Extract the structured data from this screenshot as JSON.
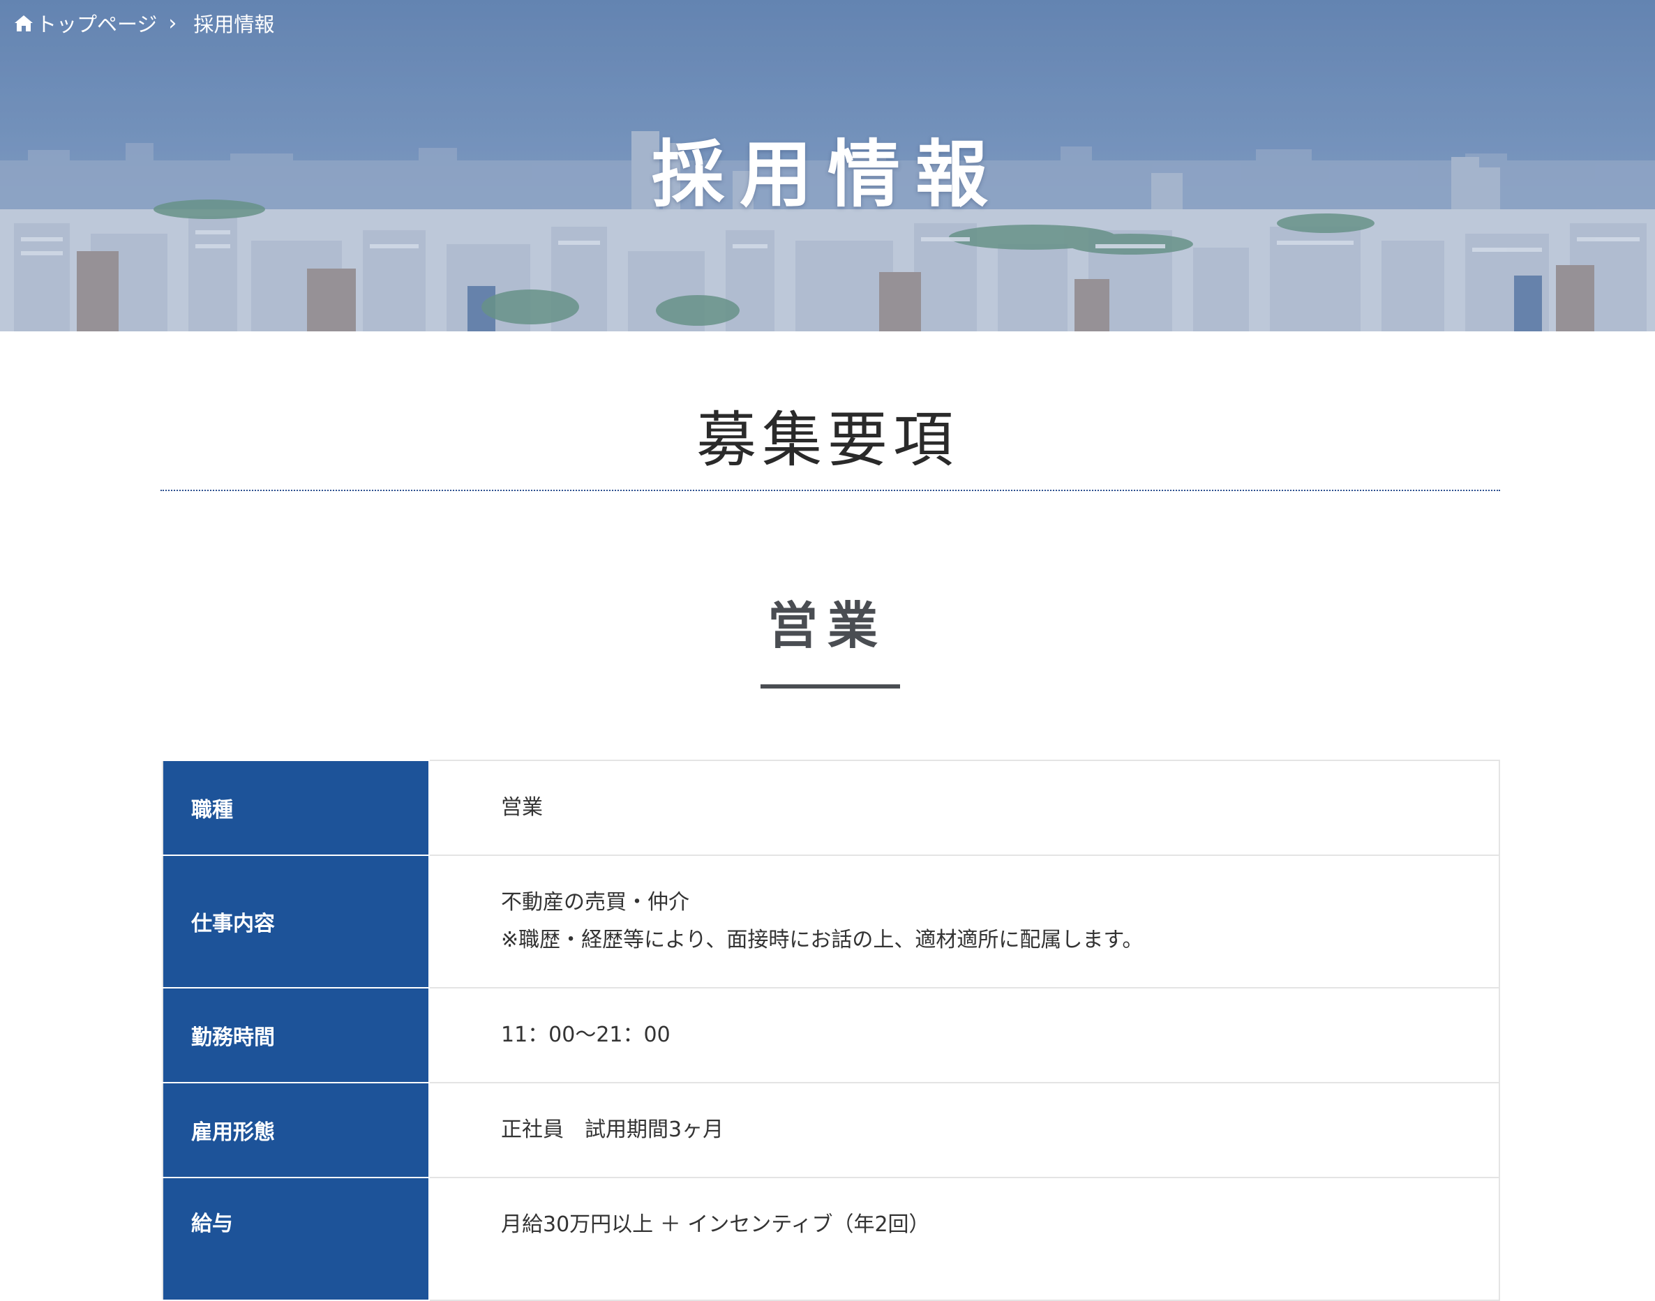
{
  "breadcrumb": {
    "home_label": "トップページ",
    "separator": "›",
    "current": "採用情報"
  },
  "hero": {
    "title": "採用情報"
  },
  "section": {
    "title": "募集要項"
  },
  "job": {
    "title": "営業"
  },
  "table": {
    "rows": [
      {
        "label": "職種",
        "lines": [
          "営業"
        ]
      },
      {
        "label": "仕事内容",
        "lines": [
          "不動産の売買・仲介",
          "※職歴・経歴等により、面接時にお話の上、適材適所に配属します。"
        ]
      },
      {
        "label": "勤務時間",
        "lines": [
          "11：00〜21：00"
        ]
      },
      {
        "label": "雇用形態",
        "lines": [
          "正社員　試用期間3ヶ月"
        ]
      },
      {
        "label": "給与",
        "lines": [
          "月給30万円以上 ＋ インセンティブ（年2回）"
        ]
      }
    ]
  },
  "colors": {
    "label_bg": "#1d5399",
    "hero_tint": "#6f8fb8",
    "rule": "#2c4f8f",
    "heading_text": "#4a4d52"
  },
  "icons": {
    "home": "home-icon"
  }
}
